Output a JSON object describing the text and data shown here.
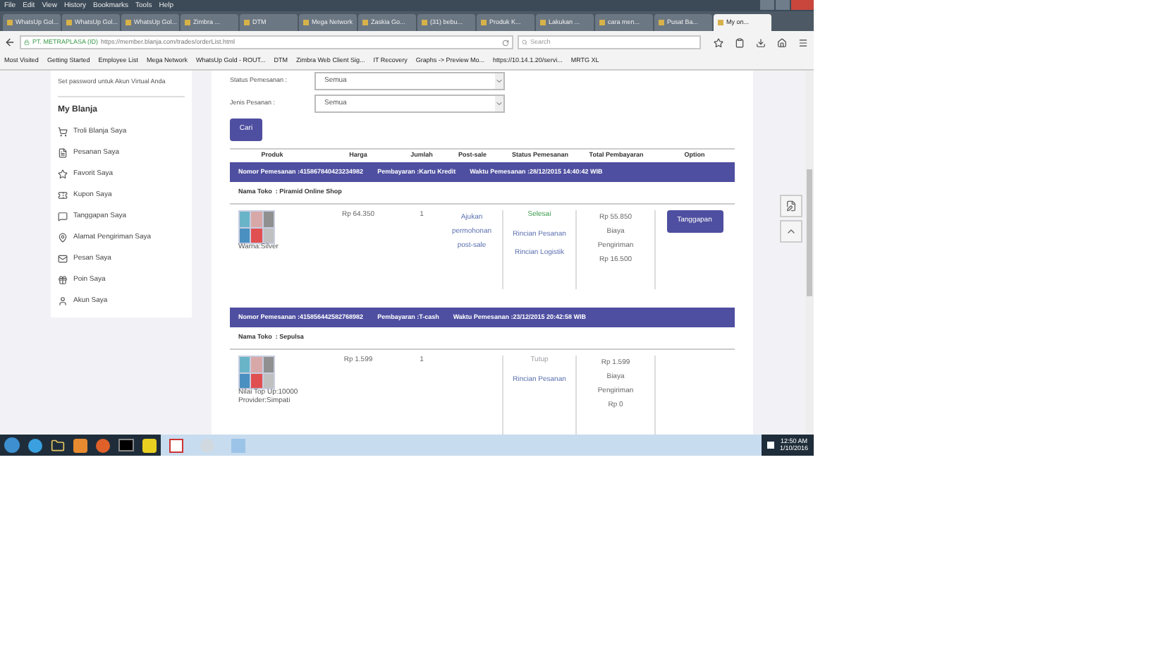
{
  "menu": [
    "File",
    "Edit",
    "View",
    "History",
    "Bookmarks",
    "Tools",
    "Help"
  ],
  "tabs": [
    {
      "label": "WhatsUp Gol...",
      "selected": false
    },
    {
      "label": "WhatsUp Gol...",
      "selected": false
    },
    {
      "label": "WhatsUp Gol...",
      "selected": false
    },
    {
      "label": "Zimbra ...",
      "selected": false
    },
    {
      "label": "DTM",
      "selected": false
    },
    {
      "label": "Mega Network",
      "selected": false
    },
    {
      "label": "Zaskia Go...",
      "selected": false
    },
    {
      "label": "(31) bebu...",
      "selected": false
    },
    {
      "label": "Produk K...",
      "selected": false
    },
    {
      "label": "Lakukan ...",
      "selected": false
    },
    {
      "label": "cara men...",
      "selected": false
    },
    {
      "label": "Pusat Ba...",
      "selected": false
    },
    {
      "label": "My on...",
      "selected": true
    }
  ],
  "address": {
    "identity": "PT. METRAPLASA (ID)",
    "url": "https://member.blanja.com/trades/orderList.html"
  },
  "search": {
    "placeholder": "Search"
  },
  "bookmarks": [
    "Most Visited",
    "Getting Started",
    "Employee List",
    "Mega Network",
    "WhatsUp Gold - ROUT...",
    "DTM",
    "Zimbra Web Client Sig...",
    "IT Recovery",
    "Graphs -> Preview Mo...",
    "https://10.14.1.20/servi...",
    "MRTG XL"
  ],
  "sidebar": {
    "notice": "Set password untuk Akun Virtual Anda",
    "heading": "My Blanja",
    "items": [
      "Troli Blanja Saya",
      "Pesanan Saya",
      "Favorit Saya",
      "Kupon Saya",
      "Tanggapan Saya",
      "Alamat Pengiriman Saya",
      "Pesan Saya",
      "Poin Saya",
      "Akun Saya"
    ]
  },
  "filters": [
    {
      "label": "Status Pemesanan :",
      "value": "Semua"
    },
    {
      "label": "Jenis Pesanan :",
      "value": "Semua"
    }
  ],
  "search_button": "Cari",
  "table": {
    "columns": [
      "Produk",
      "Harga",
      "Jumlah",
      "Post-sale",
      "Status Pemesanan",
      "Total Pembayaran",
      "Option"
    ],
    "orders": [
      {
        "number": "Nomor Pemesanan :415867840423234982",
        "payment": "Pembayaran :Kartu Kredit",
        "time": "Waktu Pemesanan :28/12/2015 14:40:42 WIB",
        "store": "Nama Toko  : Piramid Online Shop",
        "attributes": [
          "Warna:Silver"
        ],
        "price": "Rp 64.350",
        "qty": "1",
        "post_sale": "Ajukan permohonan post-sale",
        "status": "Selesai",
        "kind": "completed",
        "links": [
          "Rincian Pesanan",
          "Rincian Logistik"
        ],
        "total": [
          "Rp 55.850",
          "Biaya",
          "Pengiriman",
          "Rp 16.500"
        ],
        "option": "Tanggapan"
      },
      {
        "number": "Nomor Pemesanan :415856442582768982",
        "payment": "Pembayaran :T-cash",
        "time": "Waktu Pemesanan :23/12/2015 20:42:58 WIB",
        "store": "Nama Toko  : Sepulsa",
        "attributes": [
          "Nilai Top Up:10000",
          "Provider:Simpati"
        ],
        "price": "Rp 1.599",
        "qty": "1",
        "status": "Tutup",
        "kind": "closed",
        "links": [
          "Rincian Pesanan"
        ],
        "total": [
          "Rp 1.599",
          "Biaya",
          "Pengiriman",
          "Rp 0"
        ]
      }
    ]
  },
  "taskbar": {
    "time": "12:50 AM",
    "date": "1/10/2016"
  }
}
